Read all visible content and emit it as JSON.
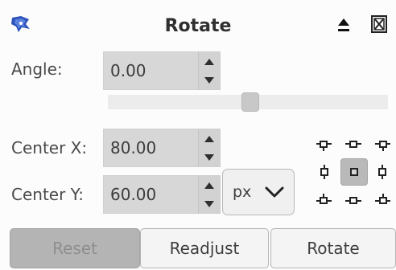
{
  "dialog": {
    "title": "Rotate",
    "icon": "rotate-tool-icon",
    "header_buttons": {
      "collapse_icon": "eject-triangle-icon",
      "close_icon": "close-box-icon"
    }
  },
  "angle": {
    "label": "Angle:",
    "value": "0.00",
    "slider_position": 0.5
  },
  "center_x": {
    "label": "Center X:",
    "value": "80.00"
  },
  "center_y": {
    "label": "Center Y:",
    "value": "60.00"
  },
  "unit": {
    "selected": "px"
  },
  "anchor_grid": {
    "selected": "center",
    "positions": [
      "top-left",
      "top-center",
      "top-right",
      "middle-left",
      "center",
      "middle-right",
      "bottom-left",
      "bottom-center",
      "bottom-right"
    ]
  },
  "buttons": {
    "reset": "Reset",
    "readjust": "Readjust",
    "rotate": "Rotate"
  }
}
